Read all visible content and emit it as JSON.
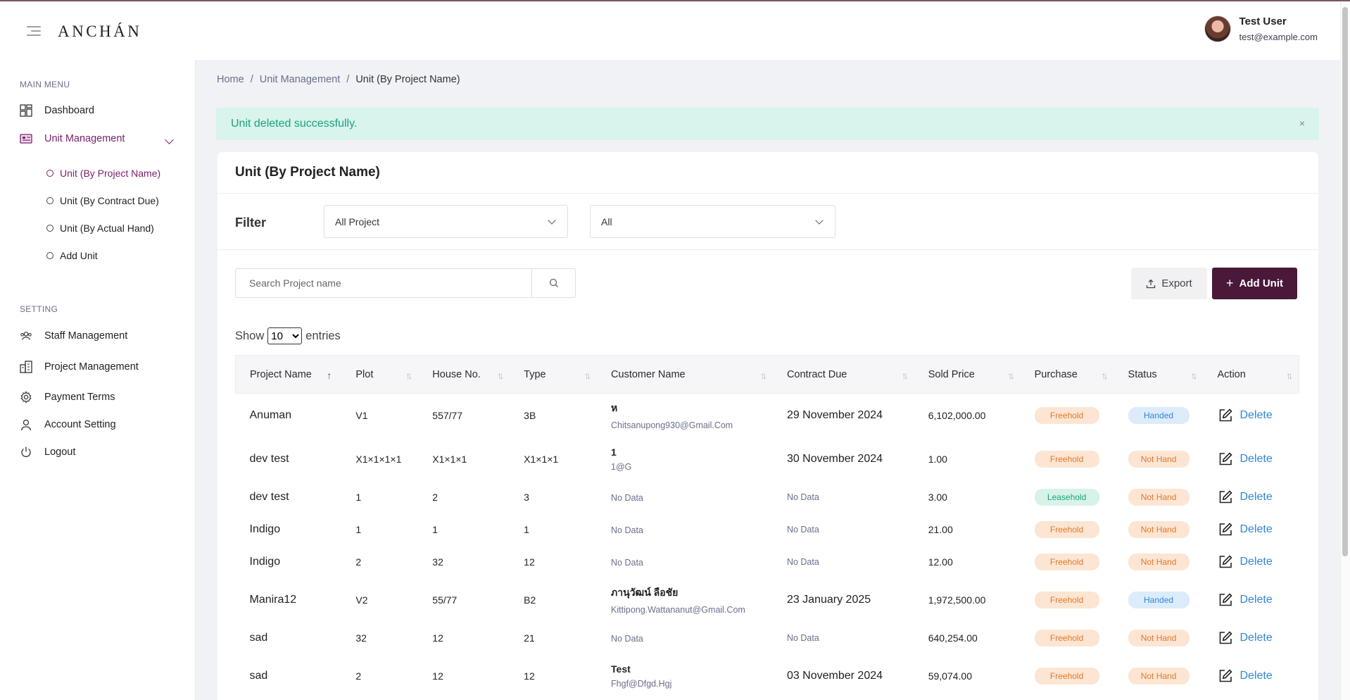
{
  "app": {
    "logo": "ANCHÁN",
    "user": {
      "name": "Test User",
      "email": "test@example.com"
    }
  },
  "sidebar": {
    "main_menu_title": "MAIN MENU",
    "dashboard": "Dashboard",
    "unit_management": "Unit Management",
    "sub_items": [
      "Unit (By Project Name)",
      "Unit (By Contract Due)",
      "Unit (By Actual Hand)",
      "Add Unit"
    ],
    "setting_title": "SETTING",
    "settings": [
      "Staff Management",
      "Project Management",
      "Payment Terms",
      "Account Setting",
      "Logout"
    ]
  },
  "breadcrumb": {
    "home": "Home",
    "section": "Unit Management",
    "current": "Unit (By Project Name)",
    "sep": "/"
  },
  "alert": {
    "message": "Unit deleted successfully.",
    "close": "×"
  },
  "card": {
    "title": "Unit (By Project Name)",
    "filter_label": "Filter",
    "project_filter": "All Project",
    "status_filter": "All",
    "search_placeholder": "Search Project name",
    "export_label": "Export",
    "add_label": "Add Unit",
    "show_label": "Show",
    "entries_label": "entries",
    "page_size": "10"
  },
  "table": {
    "headers": [
      "Project Name",
      "Plot",
      "House No.",
      "Type",
      "Customer Name",
      "Contract Due",
      "Sold Price",
      "Purchase",
      "Status",
      "Action"
    ],
    "no_data": "No Data",
    "delete_label": "Delete",
    "rows": [
      {
        "project": "Anuman",
        "plot": "V1",
        "house": "557/77",
        "type": "3B",
        "cust_name": "ห",
        "cust_email": "Chitsanupong930@Gmail.Com",
        "due": "29 November 2024",
        "price": "6,102,000.00",
        "purchase": "Freehold",
        "status": "Handed"
      },
      {
        "project": "dev test",
        "plot": "X1×1×1×1",
        "house": "X1×1×1",
        "type": "X1×1×1",
        "cust_name": "1",
        "cust_email": "1@G",
        "due": "30 November 2024",
        "price": "1.00",
        "purchase": "Freehold",
        "status": "Not Hand"
      },
      {
        "project": "dev test",
        "plot": "1",
        "house": "2",
        "type": "3",
        "cust_name": "",
        "cust_email": "",
        "due": "",
        "price": "3.00",
        "purchase": "Leasehold",
        "status": "Not Hand"
      },
      {
        "project": "Indigo",
        "plot": "1",
        "house": "1",
        "type": "1",
        "cust_name": "",
        "cust_email": "",
        "due": "",
        "price": "21.00",
        "purchase": "Freehold",
        "status": "Not Hand"
      },
      {
        "project": "Indigo",
        "plot": "2",
        "house": "32",
        "type": "12",
        "cust_name": "",
        "cust_email": "",
        "due": "",
        "price": "12.00",
        "purchase": "Freehold",
        "status": "Not Hand"
      },
      {
        "project": "Manira12",
        "plot": "V2",
        "house": "55/77",
        "type": "B2",
        "cust_name": "ภานุวัฒน์ ลือชัย",
        "cust_email": "Kittipong.Wattananut@Gmail.Com",
        "due": "23 January 2025",
        "price": "1,972,500.00",
        "purchase": "Freehold",
        "status": "Handed"
      },
      {
        "project": "sad",
        "plot": "32",
        "house": "12",
        "type": "21",
        "cust_name": "",
        "cust_email": "",
        "due": "",
        "price": "640,254.00",
        "purchase": "Freehold",
        "status": "Not Hand"
      },
      {
        "project": "sad",
        "plot": "2",
        "house": "12",
        "type": "12",
        "cust_name": "Test",
        "cust_email": "Fhgf@Dfgd.Hgj",
        "due": "03 November 2024",
        "price": "59,074.00",
        "purchase": "Freehold",
        "status": "Not Hand"
      }
    ]
  }
}
